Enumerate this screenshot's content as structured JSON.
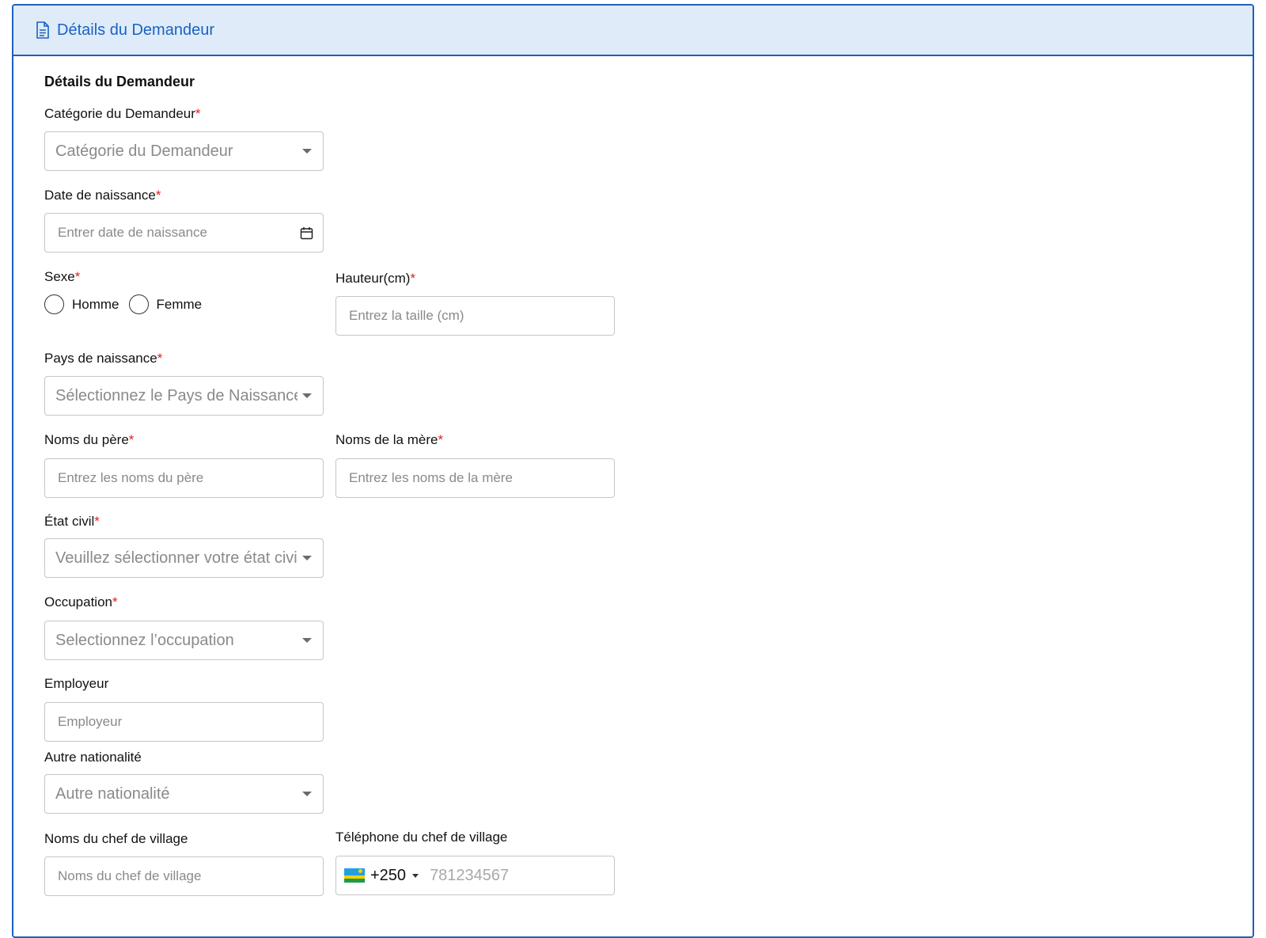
{
  "header": {
    "title": "Détails du Demandeur",
    "icon": "document-icon"
  },
  "section_title": "Détails du Demandeur",
  "required_mark": "*",
  "fields": {
    "category": {
      "label": "Catégorie du Demandeur",
      "placeholder": "Catégorie du Demandeur"
    },
    "birth_date": {
      "label": "Date de naissance",
      "placeholder": "Entrer date de naissance"
    },
    "sex": {
      "label": "Sexe",
      "options": [
        "Homme",
        "Femme"
      ]
    },
    "height": {
      "label": "Hauteur(cm)",
      "placeholder": "Entrez la taille (cm)"
    },
    "birth_country": {
      "label": "Pays de naissance",
      "placeholder": "Sélectionnez le Pays de Naissance"
    },
    "father_names": {
      "label": "Noms du père",
      "placeholder": "Entrez les noms du père"
    },
    "mother_names": {
      "label": "Noms de la mère",
      "placeholder": "Entrez les noms de la mère"
    },
    "civil_status": {
      "label": "État civil",
      "placeholder": "Veuillez sélectionner votre état civi"
    },
    "occupation": {
      "label": "Occupation",
      "placeholder": "Selectionnez l’occupation"
    },
    "employer": {
      "label": "Employeur",
      "placeholder": "Employeur"
    },
    "other_nationality": {
      "label": "Autre nationalité",
      "placeholder": "Autre nationalité"
    },
    "village_chief_names": {
      "label": "Noms du chef de village",
      "placeholder": "Noms du chef de village"
    },
    "village_chief_phone": {
      "label": "Téléphone du chef de village",
      "dial_code": "+250",
      "placeholder": "781234567"
    }
  },
  "colors": {
    "accent": "#1a62c4",
    "header_bg": "#dfebf8",
    "required": "#e02020",
    "border": "#c6c6c6"
  }
}
